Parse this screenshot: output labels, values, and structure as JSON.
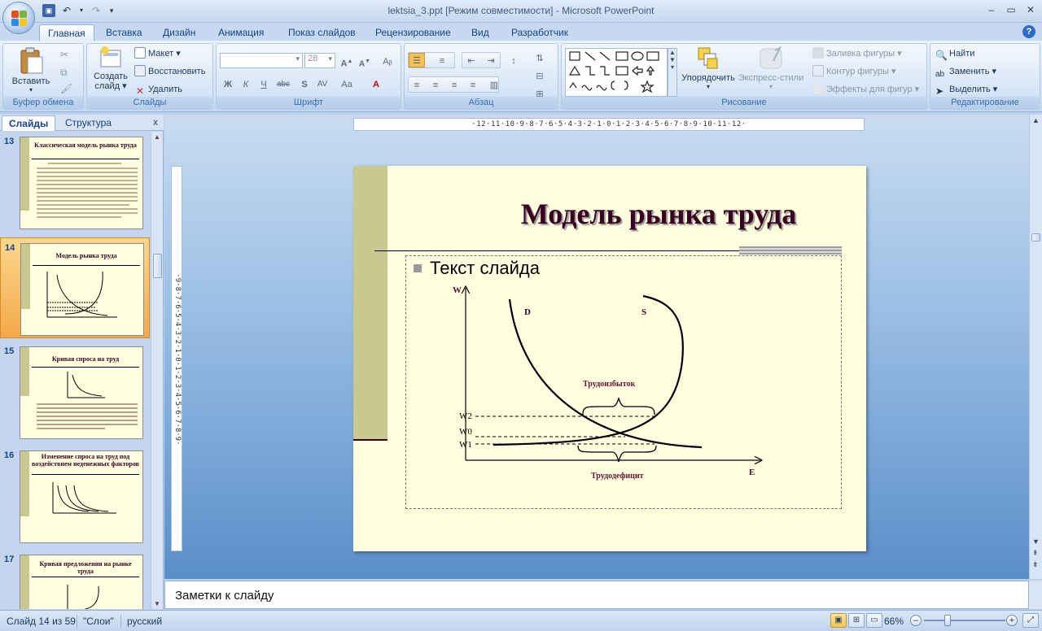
{
  "window": {
    "title": "lektsia_3.ppt [Режим совместимости] - Microsoft PowerPoint"
  },
  "tabs": [
    "Главная",
    "Вставка",
    "Дизайн",
    "Анимация",
    "Показ слайдов",
    "Рецензирование",
    "Вид",
    "Разработчик"
  ],
  "ribbon": {
    "clipboard": {
      "label": "Буфер обмена",
      "paste": "Вставить"
    },
    "slides": {
      "label": "Слайды",
      "new_slide": "Создать слайд",
      "layout": "Макет",
      "reset": "Восстановить",
      "delete": "Удалить"
    },
    "font": {
      "label": "Шрифт",
      "size": "28"
    },
    "paragraph": {
      "label": "Абзац"
    },
    "drawing": {
      "label": "Рисование",
      "arrange": "Упорядочить",
      "quick_styles": "Экспресс-стили",
      "fill": "Заливка фигуры",
      "outline": "Контур фигуры",
      "effects": "Эффекты для фигур"
    },
    "editing": {
      "label": "Редактирование",
      "find": "Найти",
      "replace": "Заменить",
      "select": "Выделить"
    }
  },
  "left_panel": {
    "tab_slides": "Слайды",
    "tab_outline": "Структура",
    "thumbnails": [
      {
        "num": "13",
        "title": "Классическая модель рынка труда",
        "selected": false
      },
      {
        "num": "14",
        "title": "Модель рынка труда",
        "selected": true
      },
      {
        "num": "15",
        "title": "Кривая спроса на труд",
        "selected": false
      },
      {
        "num": "16",
        "title": "Изменение спроса на труд под воздействием неденежных факторов",
        "selected": false
      },
      {
        "num": "17",
        "title": "Кривая предложения на рынке труда",
        "selected": false
      }
    ]
  },
  "ruler": {
    "horizontal": "·12·11·10·9·8·7·6·5·4·3·2·1·0·1·2·3·4·5·6·7·8·9·10·11·12·",
    "vertical": "·9·8·7·6·5·4·3·2·1·0·1·2·3·4·5·6·7·8·9·"
  },
  "slide": {
    "title": "Модель рынка труда",
    "bullet": "Текст слайда",
    "graph": {
      "axis_y": "W",
      "axis_x": "E",
      "demand": "D",
      "supply": "S",
      "w2": "W2",
      "w0": "W0",
      "w1": "W1",
      "surplus": "Трудоизбыток",
      "deficit": "Трудодефицит"
    }
  },
  "notes": {
    "placeholder": "Заметки к слайду"
  },
  "status": {
    "slide_info": "Слайд 14 из 59",
    "theme": "\"Слои\"",
    "language": "русский",
    "zoom": "66%"
  }
}
